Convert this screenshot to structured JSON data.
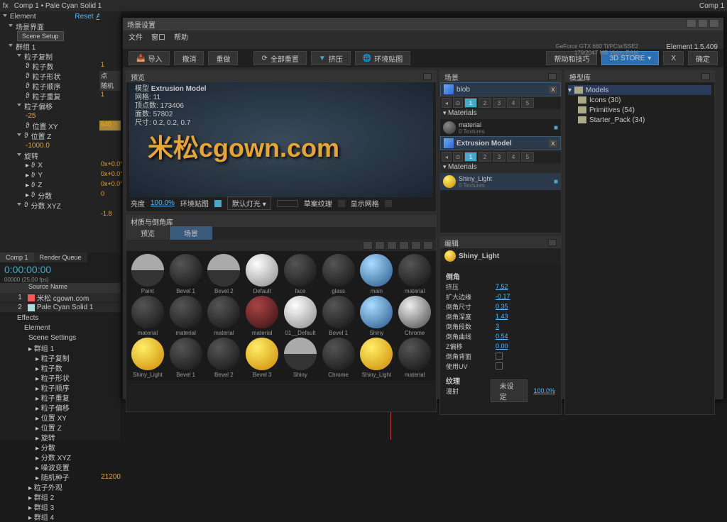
{
  "ae_top": {
    "comp": "Comp 1",
    "layer": "Pale Cyan Solid 1",
    "effect": "Element",
    "reset": "Reset",
    "about": "About...",
    "comp_tab": "Comp 1"
  },
  "left": {
    "scene_ui": "场景界面",
    "scene_setup": "Scene Setup",
    "group1": "群组 1",
    "particle_copy": "粒子复制",
    "p_count": "粒子数",
    "p_shape": "粒子形状",
    "p_order": "粒子顺序",
    "p_repeat": "粒子重复",
    "p_offset": "粒子偏移",
    "offset_val": "-25",
    "pos_xy": "位置 XY",
    "pos_z": "位置 Z",
    "pos_z_val": "-1000.0",
    "rotate": "旋转",
    "rx": "X",
    "ry": "Y",
    "rz": "Z",
    "scatter": "分散",
    "scale": "分数 XYZ",
    "xy_640": "640",
    "scale_val": "-1.8",
    "shape_point": "点",
    "order_rand": "随机",
    "one": "1",
    "rot_vals": {
      "x": "0x+0.0°",
      "y": "0x+0.0°",
      "z": "0x+0.0°",
      "s": "0"
    }
  },
  "tl": {
    "comp_tab": "Comp 1",
    "render_queue": "Render Queue",
    "timecode": "0:00:00:00",
    "fps": "00000 (25.00 fps)",
    "source_name": "Source Name",
    "layers": [
      {
        "n": "1",
        "name": "米松 cgown.com",
        "color": "#f55"
      },
      {
        "n": "2",
        "name": "Pale Cyan Solid 1",
        "color": "#add"
      }
    ],
    "effects": "Effects",
    "element": "Element",
    "scene_settings": "Scene Settings",
    "props": [
      "群组 1",
      "粒子复制",
      "粒子数",
      "粒子形状",
      "粒子顺序",
      "粒子重复",
      "粒子偏移",
      "位置 XY",
      "位置 Z",
      "旋转",
      "分散",
      "分数 XYZ",
      "噪波变置",
      "随机种子",
      "粒子外观",
      "群组 2",
      "群组 3",
      "群组 4"
    ],
    "seed": "21200"
  },
  "dlg": {
    "title": "场景设置",
    "menu": [
      "文件",
      "窗口",
      "帮助"
    ],
    "gpu": "GeForce GTX 660 Ti/PCIe/SSE2",
    "vram": "179/2047 MB Video RAM",
    "elem": "Element",
    "ver": "1.5.409",
    "tb": {
      "import": "导入",
      "undo": "撤消",
      "redo": "重做",
      "reset_all": "全部重置",
      "extrude": "挤压",
      "env": "环境贴图",
      "help": "帮助和技巧",
      "store": "3D STORE",
      "x": "X",
      "ok": "确定"
    },
    "preview": {
      "head": "预览",
      "model_type_lbl": "模型",
      "model_type": "Extrusion Model",
      "mesh_lbl": "网格:",
      "mesh": "11",
      "verts_lbl": "顶点数:",
      "verts": "173406",
      "faces_lbl": "面数:",
      "faces": "57802",
      "size_lbl": "尺寸:",
      "size": "0.2, 0.2, 0.7",
      "logo": "米松cgown.com",
      "brightness_lbl": "亮度",
      "brightness_val": "100.0%",
      "env_lbl": "环境贴图",
      "light_dd": "默认灯光",
      "wire_lbl": "草案纹理",
      "grid_lbl": "显示网格"
    },
    "materials": {
      "head": "材质与倒角库",
      "tabs": [
        "预览",
        "场景"
      ],
      "items": [
        {
          "n": "Paint",
          "c": "ball-half"
        },
        {
          "n": "Bevel 1",
          "c": "ball-dark"
        },
        {
          "n": "Bevel 2",
          "c": "ball-half"
        },
        {
          "n": "Default",
          "c": "ball-white"
        },
        {
          "n": "face",
          "c": "ball-dark"
        },
        {
          "n": "glass",
          "c": "ball-dark"
        },
        {
          "n": "main",
          "c": "ball-sky"
        },
        {
          "n": "material",
          "c": "ball-dark"
        },
        {
          "n": "material",
          "c": "ball-dark"
        },
        {
          "n": "material",
          "c": "ball-dark"
        },
        {
          "n": "material",
          "c": "ball-dark"
        },
        {
          "n": "material",
          "c": "ball-red"
        },
        {
          "n": "01__Default",
          "c": "ball-white"
        },
        {
          "n": "Bevel 1",
          "c": "ball-dark"
        },
        {
          "n": "Shiny",
          "c": "ball-sky"
        },
        {
          "n": "Chrome",
          "c": "ball-chrome"
        },
        {
          "n": "Shiny_Light",
          "c": "ball-gold"
        },
        {
          "n": "Bevel 1",
          "c": "ball-dark"
        },
        {
          "n": "Bevel 2",
          "c": "ball-dark"
        },
        {
          "n": "Bevel 3",
          "c": "ball-gold"
        },
        {
          "n": "Shiny",
          "c": "ball-half"
        },
        {
          "n": "Chrome",
          "c": "ball-dark"
        },
        {
          "n": "Shiny_Light",
          "c": "ball-gold"
        },
        {
          "n": "material",
          "c": "ball-dark"
        }
      ]
    },
    "scene": {
      "head": "场景",
      "blob": "blob",
      "ext_model": "Extrusion Model",
      "mat_head": "Materials",
      "slots": [
        "1",
        "2",
        "3",
        "4",
        "5"
      ],
      "mat1": {
        "name": "material",
        "sub": "0 Textures"
      },
      "mat2": {
        "name": "Shiny_Light",
        "sub": "0 Textures"
      }
    },
    "edit": {
      "head": "编辑",
      "name": "Shiny_Light",
      "sect1": "倒角",
      "props": [
        {
          "l": "挤压",
          "v": "7.52"
        },
        {
          "l": "扩大边缘",
          "v": "-0.17"
        },
        {
          "l": "倒角尺寸",
          "v": "0.35"
        },
        {
          "l": "倒角深度",
          "v": "1.43"
        },
        {
          "l": "倒角段数",
          "v": "3"
        },
        {
          "l": "倒角曲线",
          "v": "0.54"
        },
        {
          "l": "Z偏移",
          "v": "0.00"
        }
      ],
      "back": "倒角背面",
      "uv": "使用UV",
      "sect2": "纹理",
      "diff": "漫射",
      "diff_val": "未设定",
      "diff_pct": "100.0%"
    },
    "models": {
      "head": "模型库",
      "root": "Models",
      "items": [
        "Icons (30)",
        "Primitives (54)",
        "Starter_Pack (34)"
      ]
    }
  }
}
